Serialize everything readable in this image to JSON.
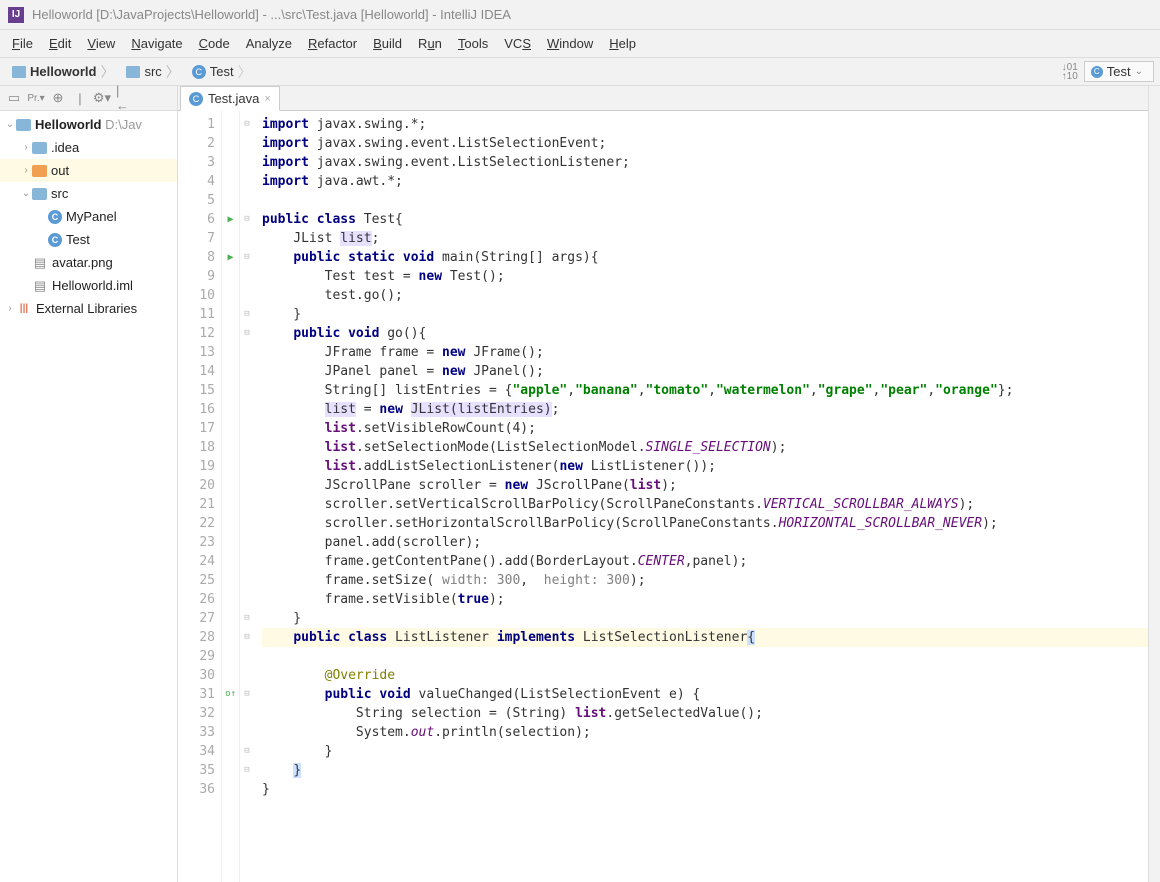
{
  "window_title": "Helloworld [D:\\JavaProjects\\Helloworld] - ...\\src\\Test.java [Helloworld] - IntelliJ IDEA",
  "menu": [
    "File",
    "Edit",
    "View",
    "Navigate",
    "Code",
    "Analyze",
    "Refactor",
    "Build",
    "Run",
    "Tools",
    "VCS",
    "Window",
    "Help"
  ],
  "breadcrumb": {
    "project": "Helloworld",
    "folder": "src",
    "class": "Test"
  },
  "run_config": "Test",
  "project_tree": {
    "root": {
      "name": "Helloworld",
      "path": "D:\\Jav"
    },
    "items": [
      {
        "kind": "folder",
        "label": ".idea",
        "indent": 1,
        "expanded": false,
        "arrow": "›"
      },
      {
        "kind": "folder-orange",
        "label": "out",
        "indent": 1,
        "expanded": false,
        "arrow": "›",
        "selected": true
      },
      {
        "kind": "folder",
        "label": "src",
        "indent": 1,
        "expanded": true,
        "arrow": "⌄"
      },
      {
        "kind": "class",
        "label": "MyPanel",
        "indent": 2
      },
      {
        "kind": "class",
        "label": "Test",
        "indent": 2
      },
      {
        "kind": "file",
        "label": "avatar.png",
        "indent": 1
      },
      {
        "kind": "file",
        "label": "Helloworld.iml",
        "indent": 1
      }
    ],
    "external": "External Libraries"
  },
  "editor_tab": {
    "name": "Test.java"
  },
  "code": {
    "line_count": 36,
    "run_markers": [
      6,
      8
    ],
    "override_markers": [
      31
    ],
    "highlighted_line": 28,
    "param_hints": {
      "line": 25,
      "width": "width: 300",
      "height": "height: 300"
    },
    "lines": {
      "1": [
        [
          "kw",
          "import"
        ],
        [
          "",
          " javax.swing.*;"
        ]
      ],
      "2": [
        [
          "kw",
          "import"
        ],
        [
          "",
          " javax.swing.event.ListSelectionEvent;"
        ]
      ],
      "3": [
        [
          "kw",
          "import"
        ],
        [
          "",
          " javax.swing.event.ListSelectionListener;"
        ]
      ],
      "4": [
        [
          "kw",
          "import"
        ],
        [
          "",
          " java.awt.*;"
        ]
      ],
      "5": [
        [
          "",
          ""
        ]
      ],
      "6": [
        [
          "kw",
          "public class"
        ],
        [
          "",
          " Test{"
        ]
      ],
      "7": [
        [
          "",
          "    JList "
        ],
        [
          "fldbg",
          "list"
        ],
        [
          "",
          ";"
        ]
      ],
      "8": [
        [
          "",
          "    "
        ],
        [
          "kw",
          "public static void"
        ],
        [
          "",
          " main(String[] args){"
        ]
      ],
      "9": [
        [
          "",
          "        Test test = "
        ],
        [
          "kw",
          "new"
        ],
        [
          "",
          " Test();"
        ]
      ],
      "10": [
        [
          "",
          "        test.go();"
        ]
      ],
      "11": [
        [
          "",
          "    }"
        ]
      ],
      "12": [
        [
          "",
          "    "
        ],
        [
          "kw",
          "public void"
        ],
        [
          "",
          " go(){"
        ]
      ],
      "13": [
        [
          "",
          "        JFrame frame = "
        ],
        [
          "kw",
          "new"
        ],
        [
          "",
          " JFrame();"
        ]
      ],
      "14": [
        [
          "",
          "        JPanel panel = "
        ],
        [
          "kw",
          "new"
        ],
        [
          "",
          " JPanel();"
        ]
      ],
      "15": [
        [
          "",
          "        String[] listEntries = {"
        ],
        [
          "str",
          "\"apple\""
        ],
        [
          "",
          ","
        ],
        [
          "str",
          "\"banana\""
        ],
        [
          "",
          ","
        ],
        [
          "str",
          "\"tomato\""
        ],
        [
          "",
          ","
        ],
        [
          "str",
          "\"watermelon\""
        ],
        [
          "",
          ","
        ],
        [
          "str",
          "\"grape\""
        ],
        [
          "",
          ","
        ],
        [
          "str",
          "\"pear\""
        ],
        [
          "",
          ","
        ],
        [
          "str",
          "\"orange\""
        ],
        [
          "",
          "};"
        ]
      ],
      "16": [
        [
          "",
          "        "
        ],
        [
          "fldbg",
          "list"
        ],
        [
          "",
          " = "
        ],
        [
          "kw",
          "new"
        ],
        [
          "",
          " "
        ],
        [
          "fldbg",
          "JList(listEntries)"
        ],
        [
          "",
          ";"
        ]
      ],
      "17": [
        [
          "",
          "        "
        ],
        [
          "fld",
          "list"
        ],
        [
          "",
          ".setVisibleRowCount("
        ],
        [
          "",
          "4"
        ],
        [
          "",
          ");"
        ]
      ],
      "18": [
        [
          "",
          "        "
        ],
        [
          "fld",
          "list"
        ],
        [
          "",
          ".setSelectionMode(ListSelectionModel."
        ],
        [
          "stf",
          "SINGLE_SELECTION"
        ],
        [
          "",
          ");"
        ]
      ],
      "19": [
        [
          "",
          "        "
        ],
        [
          "fld",
          "list"
        ],
        [
          "",
          ".addListSelectionListener("
        ],
        [
          "kw",
          "new"
        ],
        [
          "",
          " ListListener());"
        ]
      ],
      "20": [
        [
          "",
          "        JScrollPane scroller = "
        ],
        [
          "kw",
          "new"
        ],
        [
          "",
          " JScrollPane("
        ],
        [
          "fld",
          "list"
        ],
        [
          "",
          ");"
        ]
      ],
      "21": [
        [
          "",
          "        scroller.setVerticalScrollBarPolicy(ScrollPaneConstants."
        ],
        [
          "stf",
          "VERTICAL_SCROLLBAR_ALWAYS"
        ],
        [
          "",
          ");"
        ]
      ],
      "22": [
        [
          "",
          "        scroller.setHorizontalScrollBarPolicy(ScrollPaneConstants."
        ],
        [
          "stf",
          "HORIZONTAL_SCROLLBAR_NEVER"
        ],
        [
          "",
          ");"
        ]
      ],
      "23": [
        [
          "",
          "        panel.add(scroller);"
        ]
      ],
      "24": [
        [
          "",
          "        frame.getContentPane().add(BorderLayout."
        ],
        [
          "stf",
          "CENTER"
        ],
        [
          "",
          ",panel);"
        ]
      ],
      "25": [
        [
          "",
          "        frame.setSize( "
        ],
        [
          "param",
          "width: 300"
        ],
        [
          "",
          ",  "
        ],
        [
          "param",
          "height: 300"
        ],
        [
          "",
          ");"
        ]
      ],
      "26": [
        [
          "",
          "        frame.setVisible("
        ],
        [
          "kw",
          "true"
        ],
        [
          "",
          ");"
        ]
      ],
      "27": [
        [
          "",
          "    }"
        ]
      ],
      "28": [
        [
          "",
          "    "
        ],
        [
          "kw",
          "public class"
        ],
        [
          "",
          " ListListener "
        ],
        [
          "kw",
          "implements"
        ],
        [
          "",
          " ListSelectionListener"
        ],
        [
          "bl-bg",
          "{"
        ]
      ],
      "29": [
        [
          "",
          ""
        ]
      ],
      "30": [
        [
          "",
          "        "
        ],
        [
          "ann",
          "@Override"
        ]
      ],
      "31": [
        [
          "",
          "        "
        ],
        [
          "kw",
          "public void"
        ],
        [
          "",
          " valueChanged(ListSelectionEvent e) {"
        ]
      ],
      "32": [
        [
          "",
          "            String selection = (String) "
        ],
        [
          "fld",
          "list"
        ],
        [
          "",
          ".getSelectedValue();"
        ]
      ],
      "33": [
        [
          "",
          "            System."
        ],
        [
          "stf",
          "out"
        ],
        [
          "",
          ".println(selection);"
        ]
      ],
      "34": [
        [
          "",
          "        }"
        ]
      ],
      "35": [
        [
          "",
          "    "
        ],
        [
          "bl-bg",
          "}"
        ]
      ],
      "36": [
        [
          "",
          "}"
        ]
      ]
    }
  }
}
